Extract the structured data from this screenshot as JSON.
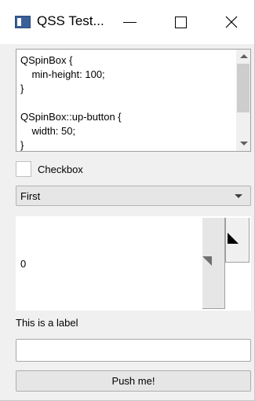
{
  "window": {
    "title": "QSS Test...",
    "controls": {
      "minimize_icon": "minimize-icon",
      "maximize_icon": "maximize-icon",
      "close_glyph": "✕"
    }
  },
  "text_edit": {
    "content": "QSpinBox {\n    min-height: 100;\n}\n\nQSpinBox::up-button {\n    width: 50;\n}"
  },
  "checkbox": {
    "label": "Checkbox",
    "checked": false
  },
  "combo": {
    "selected": "First"
  },
  "spinbox": {
    "value": "0"
  },
  "label": {
    "text": "This is a label"
  },
  "line_edit": {
    "value": "",
    "placeholder": ""
  },
  "push_button": {
    "label": "Push me!"
  }
}
